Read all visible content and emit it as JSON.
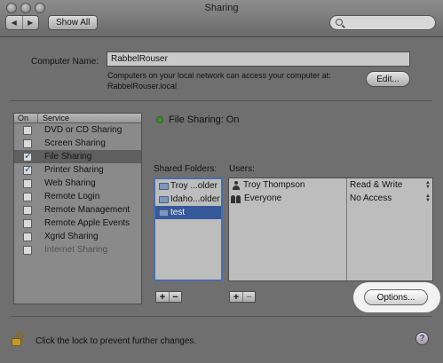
{
  "window": {
    "title": "Sharing",
    "show_all_label": "Show All",
    "back_symbol": "◀",
    "forward_symbol": "▶",
    "search_placeholder": ""
  },
  "computer": {
    "name_label": "Computer Name:",
    "name_value": "RabbelRouser",
    "info_line1": "Computers on your local network can access your computer at:",
    "info_line2": "RabbelRouser.local",
    "edit_label": "Edit..."
  },
  "services": {
    "header_on": "On",
    "header_service": "Service",
    "items": [
      {
        "label": "DVD or CD Sharing",
        "checked": false,
        "selected": false,
        "dim": false
      },
      {
        "label": "Screen Sharing",
        "checked": false,
        "selected": false,
        "dim": false
      },
      {
        "label": "File Sharing",
        "checked": true,
        "selected": true,
        "dim": false
      },
      {
        "label": "Printer Sharing",
        "checked": true,
        "selected": false,
        "dim": false
      },
      {
        "label": "Web Sharing",
        "checked": false,
        "selected": false,
        "dim": false
      },
      {
        "label": "Remote Login",
        "checked": false,
        "selected": false,
        "dim": false
      },
      {
        "label": "Remote Management",
        "checked": false,
        "selected": false,
        "dim": false
      },
      {
        "label": "Remote Apple Events",
        "checked": false,
        "selected": false,
        "dim": false
      },
      {
        "label": "Xgrid Sharing",
        "checked": false,
        "selected": false,
        "dim": false
      },
      {
        "label": "Internet Sharing",
        "checked": false,
        "selected": false,
        "dim": true
      }
    ]
  },
  "status": {
    "text": "File Sharing: On",
    "color": "#3b8f2e"
  },
  "shared_folders": {
    "label": "Shared Folders:",
    "items": [
      {
        "label": "Troy ...older",
        "selected": false
      },
      {
        "label": "Idaho...older",
        "selected": false
      },
      {
        "label": "test",
        "selected": true
      }
    ]
  },
  "users": {
    "label": "Users:",
    "items": [
      {
        "name": "Troy Thompson",
        "permission": "Read & Write",
        "icon": "user-icon"
      },
      {
        "name": "Everyone",
        "permission": "No Access",
        "icon": "group-icon"
      }
    ]
  },
  "controls": {
    "plus": "+",
    "minus": "−",
    "options_label": "Options...",
    "updown_up": "▲",
    "updown_down": "▼"
  },
  "footer": {
    "lock_text": "Click the lock to prevent further changes.",
    "help_label": "?"
  }
}
